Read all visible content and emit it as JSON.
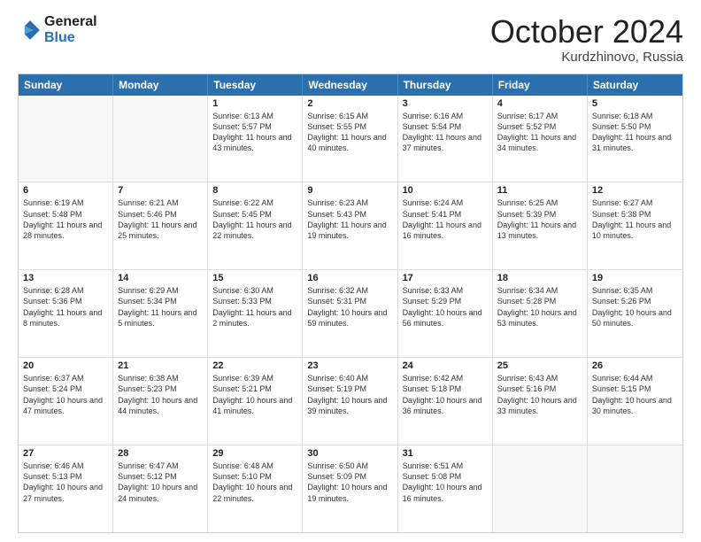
{
  "header": {
    "logo": {
      "line1": "General",
      "line2": "Blue"
    },
    "month": "October 2024",
    "location": "Kurdzhinovo, Russia"
  },
  "weekdays": [
    "Sunday",
    "Monday",
    "Tuesday",
    "Wednesday",
    "Thursday",
    "Friday",
    "Saturday"
  ],
  "rows": [
    [
      {
        "day": "",
        "empty": true
      },
      {
        "day": "",
        "empty": true
      },
      {
        "day": "1",
        "sunrise": "Sunrise: 6:13 AM",
        "sunset": "Sunset: 5:57 PM",
        "daylight": "Daylight: 11 hours and 43 minutes."
      },
      {
        "day": "2",
        "sunrise": "Sunrise: 6:15 AM",
        "sunset": "Sunset: 5:55 PM",
        "daylight": "Daylight: 11 hours and 40 minutes."
      },
      {
        "day": "3",
        "sunrise": "Sunrise: 6:16 AM",
        "sunset": "Sunset: 5:54 PM",
        "daylight": "Daylight: 11 hours and 37 minutes."
      },
      {
        "day": "4",
        "sunrise": "Sunrise: 6:17 AM",
        "sunset": "Sunset: 5:52 PM",
        "daylight": "Daylight: 11 hours and 34 minutes."
      },
      {
        "day": "5",
        "sunrise": "Sunrise: 6:18 AM",
        "sunset": "Sunset: 5:50 PM",
        "daylight": "Daylight: 11 hours and 31 minutes."
      }
    ],
    [
      {
        "day": "6",
        "sunrise": "Sunrise: 6:19 AM",
        "sunset": "Sunset: 5:48 PM",
        "daylight": "Daylight: 11 hours and 28 minutes."
      },
      {
        "day": "7",
        "sunrise": "Sunrise: 6:21 AM",
        "sunset": "Sunset: 5:46 PM",
        "daylight": "Daylight: 11 hours and 25 minutes."
      },
      {
        "day": "8",
        "sunrise": "Sunrise: 6:22 AM",
        "sunset": "Sunset: 5:45 PM",
        "daylight": "Daylight: 11 hours and 22 minutes."
      },
      {
        "day": "9",
        "sunrise": "Sunrise: 6:23 AM",
        "sunset": "Sunset: 5:43 PM",
        "daylight": "Daylight: 11 hours and 19 minutes."
      },
      {
        "day": "10",
        "sunrise": "Sunrise: 6:24 AM",
        "sunset": "Sunset: 5:41 PM",
        "daylight": "Daylight: 11 hours and 16 minutes."
      },
      {
        "day": "11",
        "sunrise": "Sunrise: 6:25 AM",
        "sunset": "Sunset: 5:39 PM",
        "daylight": "Daylight: 11 hours and 13 minutes."
      },
      {
        "day": "12",
        "sunrise": "Sunrise: 6:27 AM",
        "sunset": "Sunset: 5:38 PM",
        "daylight": "Daylight: 11 hours and 10 minutes."
      }
    ],
    [
      {
        "day": "13",
        "sunrise": "Sunrise: 6:28 AM",
        "sunset": "Sunset: 5:36 PM",
        "daylight": "Daylight: 11 hours and 8 minutes."
      },
      {
        "day": "14",
        "sunrise": "Sunrise: 6:29 AM",
        "sunset": "Sunset: 5:34 PM",
        "daylight": "Daylight: 11 hours and 5 minutes."
      },
      {
        "day": "15",
        "sunrise": "Sunrise: 6:30 AM",
        "sunset": "Sunset: 5:33 PM",
        "daylight": "Daylight: 11 hours and 2 minutes."
      },
      {
        "day": "16",
        "sunrise": "Sunrise: 6:32 AM",
        "sunset": "Sunset: 5:31 PM",
        "daylight": "Daylight: 10 hours and 59 minutes."
      },
      {
        "day": "17",
        "sunrise": "Sunrise: 6:33 AM",
        "sunset": "Sunset: 5:29 PM",
        "daylight": "Daylight: 10 hours and 56 minutes."
      },
      {
        "day": "18",
        "sunrise": "Sunrise: 6:34 AM",
        "sunset": "Sunset: 5:28 PM",
        "daylight": "Daylight: 10 hours and 53 minutes."
      },
      {
        "day": "19",
        "sunrise": "Sunrise: 6:35 AM",
        "sunset": "Sunset: 5:26 PM",
        "daylight": "Daylight: 10 hours and 50 minutes."
      }
    ],
    [
      {
        "day": "20",
        "sunrise": "Sunrise: 6:37 AM",
        "sunset": "Sunset: 5:24 PM",
        "daylight": "Daylight: 10 hours and 47 minutes."
      },
      {
        "day": "21",
        "sunrise": "Sunrise: 6:38 AM",
        "sunset": "Sunset: 5:23 PM",
        "daylight": "Daylight: 10 hours and 44 minutes."
      },
      {
        "day": "22",
        "sunrise": "Sunrise: 6:39 AM",
        "sunset": "Sunset: 5:21 PM",
        "daylight": "Daylight: 10 hours and 41 minutes."
      },
      {
        "day": "23",
        "sunrise": "Sunrise: 6:40 AM",
        "sunset": "Sunset: 5:19 PM",
        "daylight": "Daylight: 10 hours and 39 minutes."
      },
      {
        "day": "24",
        "sunrise": "Sunrise: 6:42 AM",
        "sunset": "Sunset: 5:18 PM",
        "daylight": "Daylight: 10 hours and 36 minutes."
      },
      {
        "day": "25",
        "sunrise": "Sunrise: 6:43 AM",
        "sunset": "Sunset: 5:16 PM",
        "daylight": "Daylight: 10 hours and 33 minutes."
      },
      {
        "day": "26",
        "sunrise": "Sunrise: 6:44 AM",
        "sunset": "Sunset: 5:15 PM",
        "daylight": "Daylight: 10 hours and 30 minutes."
      }
    ],
    [
      {
        "day": "27",
        "sunrise": "Sunrise: 6:46 AM",
        "sunset": "Sunset: 5:13 PM",
        "daylight": "Daylight: 10 hours and 27 minutes."
      },
      {
        "day": "28",
        "sunrise": "Sunrise: 6:47 AM",
        "sunset": "Sunset: 5:12 PM",
        "daylight": "Daylight: 10 hours and 24 minutes."
      },
      {
        "day": "29",
        "sunrise": "Sunrise: 6:48 AM",
        "sunset": "Sunset: 5:10 PM",
        "daylight": "Daylight: 10 hours and 22 minutes."
      },
      {
        "day": "30",
        "sunrise": "Sunrise: 6:50 AM",
        "sunset": "Sunset: 5:09 PM",
        "daylight": "Daylight: 10 hours and 19 minutes."
      },
      {
        "day": "31",
        "sunrise": "Sunrise: 6:51 AM",
        "sunset": "Sunset: 5:08 PM",
        "daylight": "Daylight: 10 hours and 16 minutes."
      },
      {
        "day": "",
        "empty": true
      },
      {
        "day": "",
        "empty": true
      }
    ]
  ]
}
